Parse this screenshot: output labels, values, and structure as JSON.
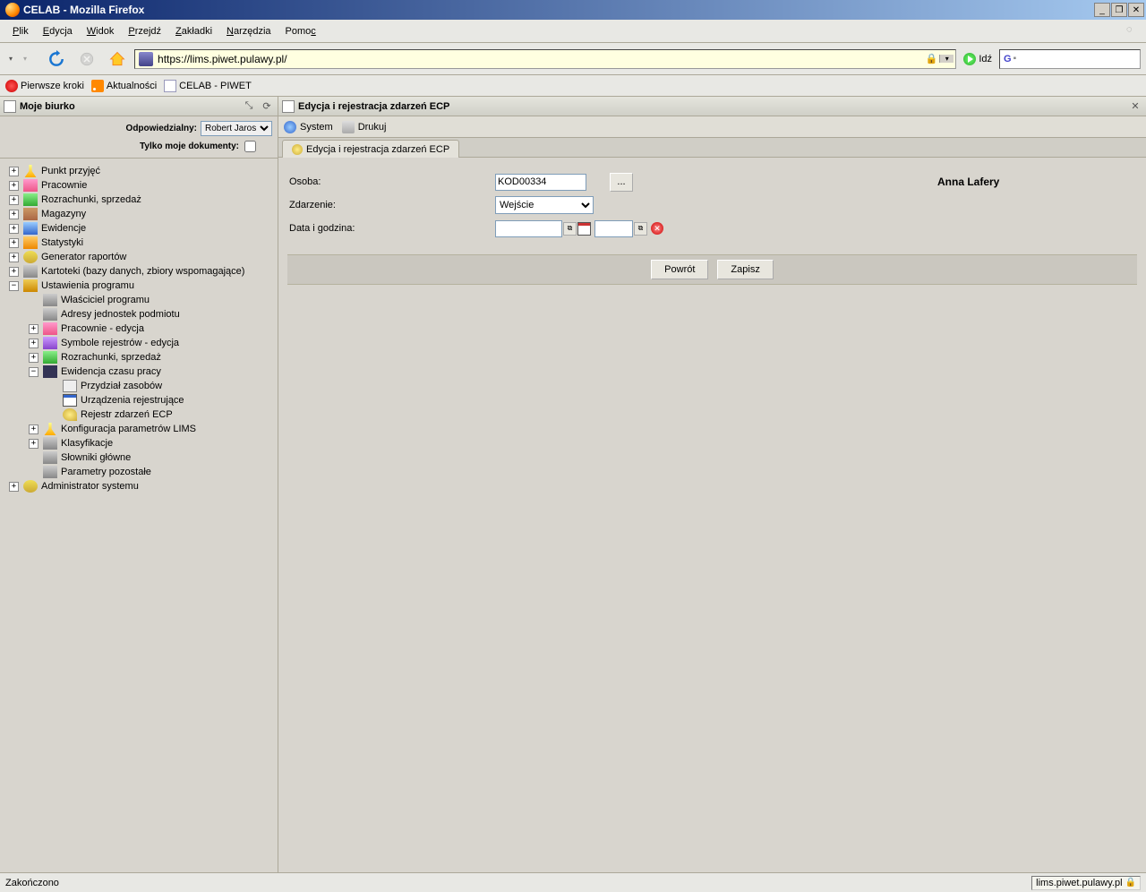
{
  "window": {
    "title": "CELAB - Mozilla Firefox"
  },
  "menu": {
    "file": "Plik",
    "edit": "Edycja",
    "view": "Widok",
    "go": "Przejdź",
    "bookmarks": "Zakładki",
    "tools": "Narzędzia",
    "help": "Pomoc"
  },
  "toolbar": {
    "url": "https://lims.piwet.pulawy.pl/",
    "go_label": "Idź"
  },
  "bookmarks": {
    "first_steps": "Pierwsze kroki",
    "news": "Aktualności",
    "celab": "CELAB - PIWET"
  },
  "sidebar": {
    "title": "Moje biurko",
    "resp_label": "Odpowiedzialny:",
    "resp_value": "Robert Jaros",
    "only_label": "Tylko moje dokumenty:",
    "nodes": {
      "punkt": "Punkt przyjęć",
      "pracownie": "Pracownie",
      "rozrachunki": "Rozrachunki, sprzedaż",
      "magazyny": "Magazyny",
      "ewidencje": "Ewidencje",
      "statystyki": "Statystyki",
      "generator": "Generator raportów",
      "kartoteki": "Kartoteki (bazy danych, zbiory wspomagające)",
      "ustawienia": "Ustawienia programu",
      "wlasciciel": "Właściciel programu",
      "adresy": "Adresy jednostek podmiotu",
      "prac_ed": "Pracownie - edycja",
      "symbole": "Symbole rejestrów - edycja",
      "rozr_sub": "Rozrachunki, sprzedaż",
      "ecp": "Ewidencja czasu pracy",
      "przydzial": "Przydział zasobów",
      "urzadzenia": "Urządzenia rejestrujące",
      "rejestr": "Rejestr zdarzeń ECP",
      "konfig": "Konfiguracja parametrów LIMS",
      "klasyfik": "Klasyfikacje",
      "slowniki": "Słowniki główne",
      "parametry": "Parametry pozostałe",
      "admin": "Administrator systemu"
    }
  },
  "content": {
    "title": "Edycja i rejestracja zdarzeń ECP",
    "system": "System",
    "print": "Drukuj",
    "tab": "Edycja i rejestracja zdarzeń ECP",
    "form": {
      "osoba_label": "Osoba:",
      "osoba_value": "KOD00334",
      "dots": "...",
      "person_name": "Anna Lafery",
      "zdarzenie_label": "Zdarzenie:",
      "zdarzenie_value": "Wejście",
      "data_label": "Data i godzina:",
      "data_value": "",
      "time_value": ""
    },
    "buttons": {
      "back": "Powrót",
      "save": "Zapisz"
    }
  },
  "status": {
    "text": "Zakończono",
    "host": "lims.piwet.pulawy.pl"
  }
}
